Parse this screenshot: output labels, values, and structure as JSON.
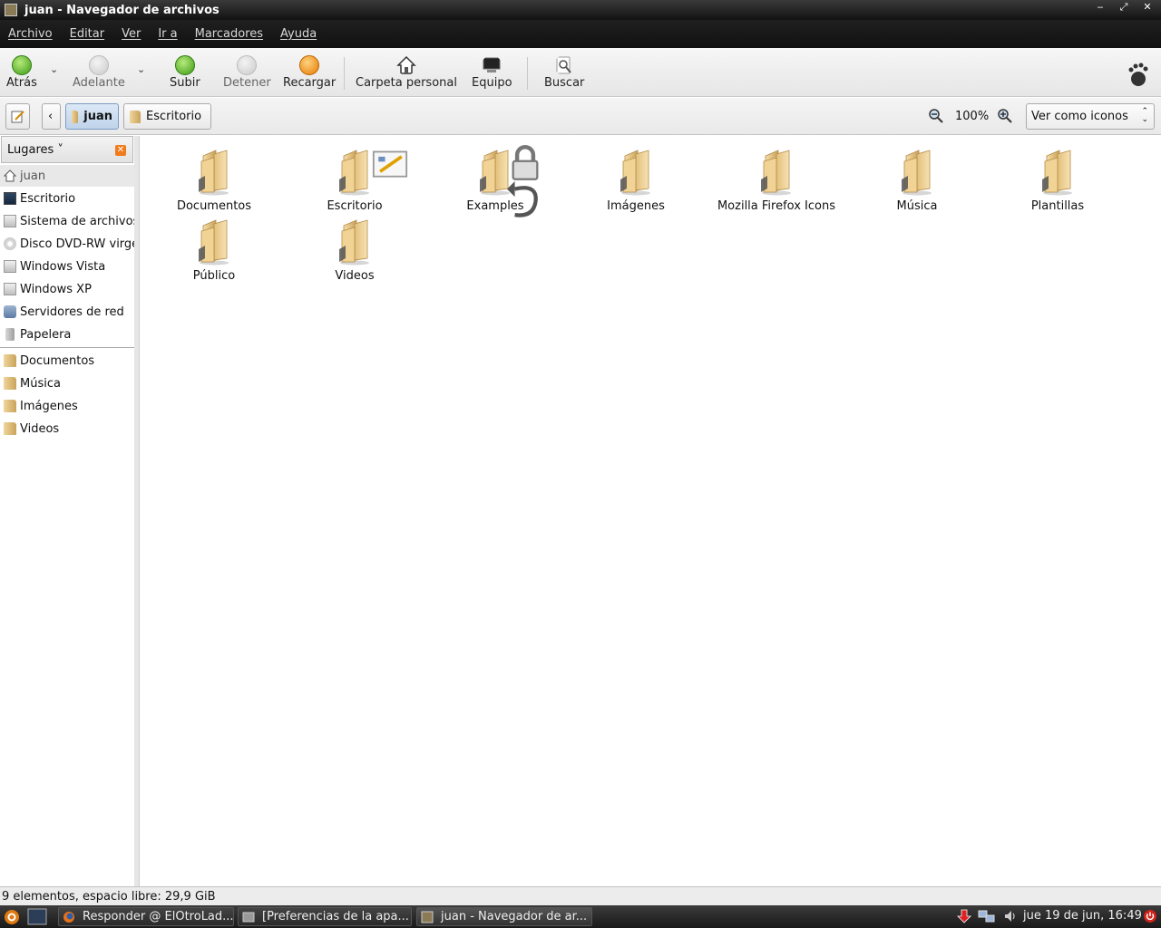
{
  "window": {
    "title": "juan - Navegador de archivos",
    "wm_buttons": [
      "‒",
      "⤢",
      "✕"
    ]
  },
  "menu": [
    "Archivo",
    "Editar",
    "Ver",
    "Ir a",
    "Marcadores",
    "Ayuda"
  ],
  "toolbar": {
    "back": "Atrás",
    "forward": "Adelante",
    "up": "Subir",
    "stop": "Detener",
    "reload": "Recargar",
    "home": "Carpeta personal",
    "computer": "Equipo",
    "search": "Buscar"
  },
  "location": {
    "back_arrow": "‹",
    "crumbs": [
      "juan",
      "Escritorio"
    ],
    "zoom": "100%",
    "view_mode": "Ver como iconos"
  },
  "sidebar": {
    "header": "Lugares ˅",
    "close": "✕",
    "places": [
      "juan",
      "Escritorio",
      "Sistema de archivos",
      "Disco DVD-RW virgen",
      "Windows Vista",
      "Windows XP",
      "Servidores de red",
      "Papelera"
    ],
    "bookmarks": [
      "Documentos",
      "Música",
      "Imágenes",
      "Videos"
    ]
  },
  "files": [
    "Documentos",
    "Escritorio",
    "Examples",
    "Imágenes",
    "Mozilla Firefox Icons",
    "Música",
    "Plantillas",
    "Público",
    "Videos"
  ],
  "status": "9 elementos, espacio libre: 29,9 GiB",
  "taskbar": {
    "tasks": [
      "Responder @ ElOtroLad...",
      "[Preferencias de la apa...",
      "juan - Navegador de ar..."
    ],
    "clock": "jue 19 de jun, 16:49"
  },
  "colors": {
    "folder_light": "#f3d8a0",
    "folder_dark": "#c39a52",
    "selection": "#bfd3ea"
  }
}
